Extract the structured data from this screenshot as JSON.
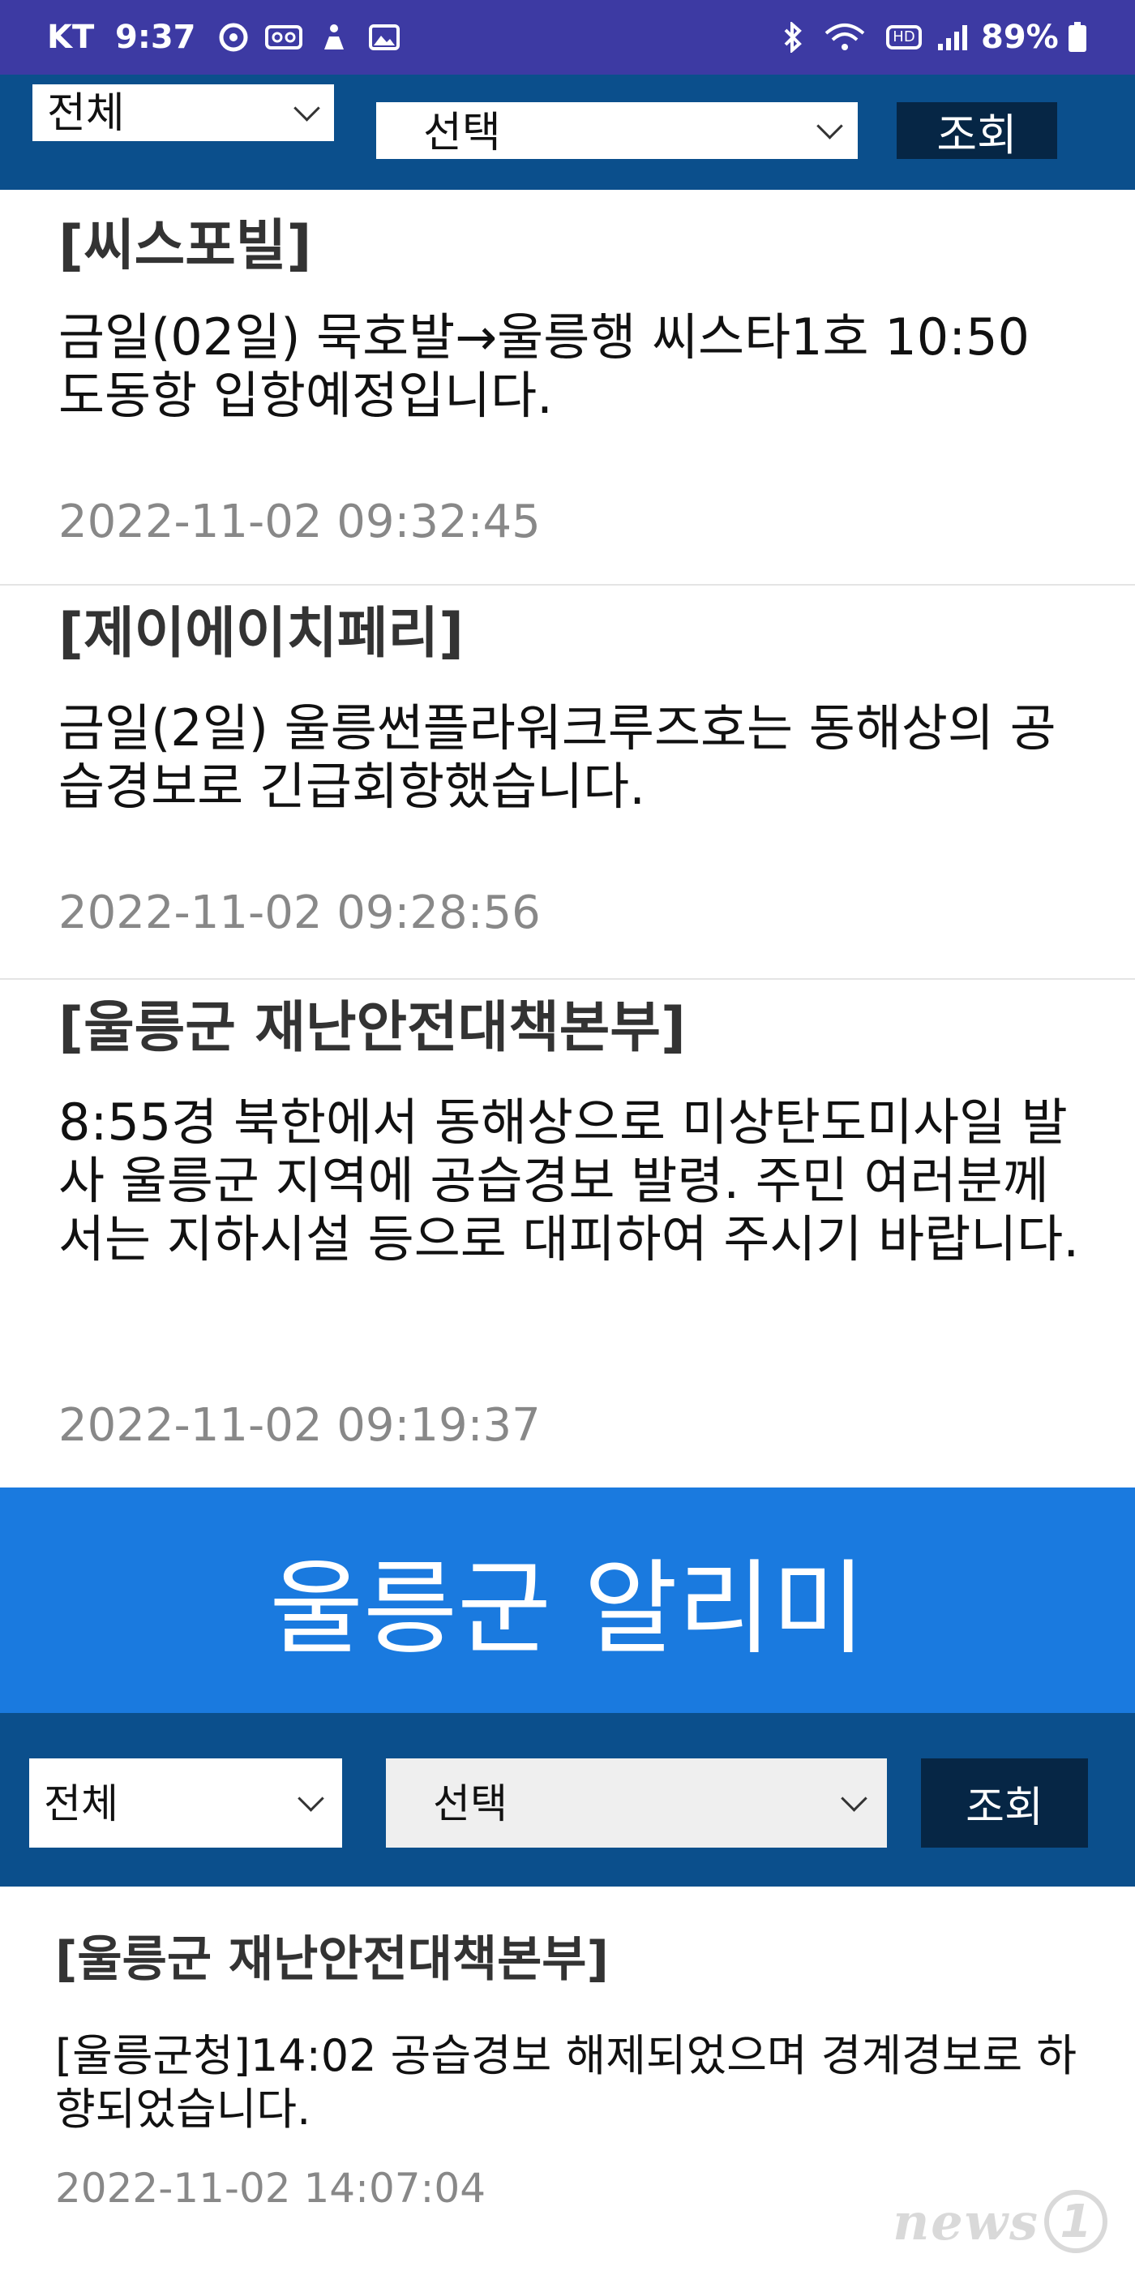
{
  "status_bar": {
    "carrier": "KT",
    "time": "9:37",
    "battery": "89%"
  },
  "filter_top": {
    "category": "전체",
    "select": "선택",
    "button": "조회"
  },
  "notices_top": [
    {
      "title": "[씨스포빌]",
      "body": "금일(02일) 묵호발→울릉행 씨스타1호 10:50 도동항 입항예정입니다.",
      "timestamp": "2022-11-02 09:32:45"
    },
    {
      "title": "[제이에이치페리]",
      "body": "금일(2일) 울릉썬플라워크루즈호는 동해상의 공습경보로 긴급회항했습니다.",
      "timestamp": "2022-11-02 09:28:56"
    },
    {
      "title": "[울릉군 재난안전대책본부]",
      "body": "8:55경 북한에서 동해상으로 미상탄도미사일 발사 울릉군 지역에 공습경보 발령. 주민 여러분께서는 지하시설 등으로 대피하여 주시기 바랍니다.",
      "timestamp": "2022-11-02 09:19:37"
    }
  ],
  "banner": {
    "title": "울릉군 알리미"
  },
  "filter_bottom": {
    "category": "전체",
    "select": "선택",
    "button": "조회"
  },
  "notices_bottom": [
    {
      "title": "[울릉군 재난안전대책본부]",
      "body": "[울릉군청]14:02 공습경보 해제되었으며 경계경보로 하향되었습니다.",
      "timestamp": "2022-11-02 14:07:04"
    }
  ],
  "watermark": {
    "brand": "news",
    "number": "1"
  },
  "colors": {
    "status_bar": "#3d3aa3",
    "filter_bar": "#0b4f8c",
    "banner": "#1a7adf",
    "button": "#062645"
  }
}
